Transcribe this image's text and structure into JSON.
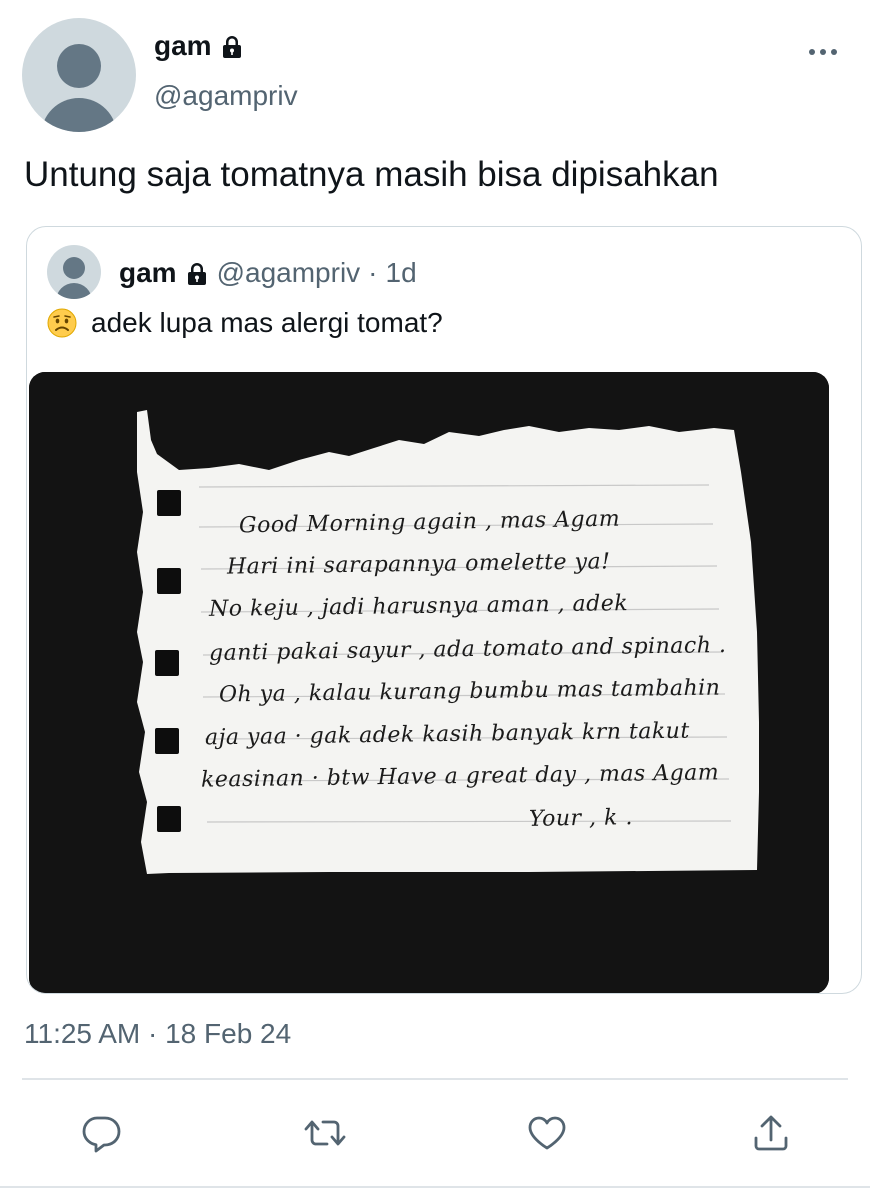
{
  "author": {
    "name": "gam",
    "handle": "@agampriv"
  },
  "tweet": {
    "text": "Untung saja tomatnya masih bisa dipisahkan",
    "timestamp": "11:25 AM · 18 Feb 24"
  },
  "quoted": {
    "name": "gam",
    "handle": "@agampriv",
    "separator": "·",
    "age": "1d",
    "emoji": "worried-face",
    "text": "adek lupa mas alergi tomat?",
    "note_lines": [
      "Good Morning again , mas Agam",
      "Hari ini sarapannya omelette ya!",
      "No keju , jadi harusnya aman , adek",
      "ganti pakai sayur , ada tomato and spinach .",
      "Oh ya , kalau kurang bumbu mas tambahin",
      "aja yaa · gak adek kasih banyak krn takut",
      "keasinan · btw Have a great day , mas Agam",
      "Your , k ."
    ]
  },
  "icons": {
    "lock": "lock-icon",
    "more": "more-icon",
    "reply": "reply-icon",
    "retweet": "retweet-icon",
    "like": "like-icon",
    "share": "share-icon"
  },
  "colors": {
    "text": "#0f1419",
    "secondary": "#536471",
    "border": "#cfd9de"
  }
}
